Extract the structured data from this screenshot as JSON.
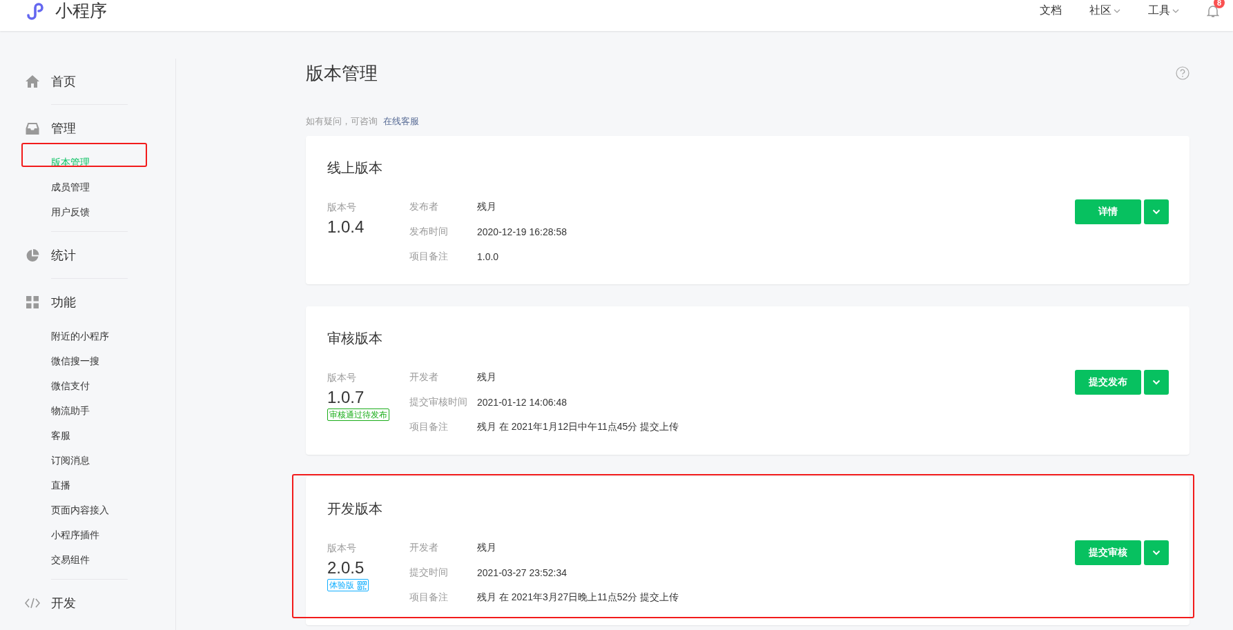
{
  "header": {
    "logo_text": "小程序",
    "nav": [
      {
        "label": "文档",
        "dropdown": false
      },
      {
        "label": "社区",
        "dropdown": true
      },
      {
        "label": "工具",
        "dropdown": true
      }
    ],
    "notification_count": "8"
  },
  "sidebar": {
    "sections": [
      {
        "label": "首页",
        "kind": "home"
      },
      {
        "label": "管理",
        "kind": "manage",
        "children": [
          {
            "label": "版本管理",
            "selected": true,
            "highlighted": true
          },
          {
            "label": "成员管理",
            "selected": false,
            "highlighted": false
          },
          {
            "label": "用户反馈",
            "selected": false,
            "highlighted": false
          }
        ]
      },
      {
        "label": "统计",
        "kind": "stats"
      },
      {
        "label": "功能",
        "kind": "features",
        "children": [
          {
            "label": "附近的小程序",
            "selected": false,
            "highlighted": false
          },
          {
            "label": "微信搜一搜",
            "selected": false,
            "highlighted": false
          },
          {
            "label": "微信支付",
            "selected": false,
            "highlighted": false
          },
          {
            "label": "物流助手",
            "selected": false,
            "highlighted": false
          },
          {
            "label": "客服",
            "selected": false,
            "highlighted": false
          },
          {
            "label": "订阅消息",
            "selected": false,
            "highlighted": false
          },
          {
            "label": "直播",
            "selected": false,
            "highlighted": false
          },
          {
            "label": "页面内容接入",
            "selected": false,
            "highlighted": false
          },
          {
            "label": "小程序插件",
            "selected": false,
            "highlighted": false
          },
          {
            "label": "交易组件",
            "selected": false,
            "highlighted": false
          }
        ]
      },
      {
        "label": "开发",
        "kind": "develop"
      }
    ]
  },
  "page": {
    "title": "版本管理",
    "help_text": "如有疑问，可咨询",
    "help_link": "在线客服"
  },
  "cards": [
    {
      "title": "线上版本",
      "highlighted": false,
      "version_label": "版本号",
      "version": "1.0.4",
      "fields": [
        {
          "label": "发布者",
          "value": "残月"
        },
        {
          "label": "发布时间",
          "value": "2020-12-19 16:28:58"
        },
        {
          "label": "项目备注",
          "value": "1.0.0"
        }
      ],
      "button": "详情"
    },
    {
      "title": "审核版本",
      "highlighted": false,
      "version_label": "版本号",
      "version": "1.0.7",
      "tag": {
        "kind": "status",
        "text": "审核通过待发布"
      },
      "fields": [
        {
          "label": "开发者",
          "value": "残月"
        },
        {
          "label": "提交审核时间",
          "value": "2021-01-12 14:06:48"
        },
        {
          "label": "项目备注",
          "value": "残月 在 2021年1月12日中午11点45分 提交上传"
        }
      ],
      "button": "提交发布"
    },
    {
      "title": "开发版本",
      "highlighted": true,
      "version_label": "版本号",
      "version": "2.0.5",
      "tag": {
        "kind": "preview",
        "text": "体验版"
      },
      "fields": [
        {
          "label": "开发者",
          "value": "残月"
        },
        {
          "label": "提交时间",
          "value": "2021-03-27 23:52:34"
        },
        {
          "label": "项目备注",
          "value": "残月 在 2021年3月27日晚上11点52分 提交上传"
        }
      ],
      "button": "提交审核"
    }
  ]
}
